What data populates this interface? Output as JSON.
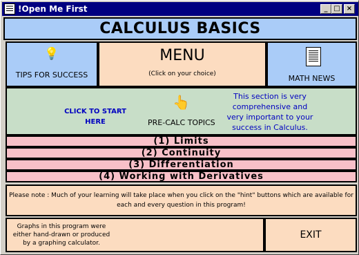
{
  "window": {
    "title": "!Open Me First",
    "minimize_label": "_",
    "maximize_label": "□",
    "close_label": "×"
  },
  "header": {
    "title": "CALCULUS BASICS"
  },
  "nav": {
    "tips_icon": "💡",
    "tips_label": "TIPS FOR SUCCESS",
    "menu_title": "MENU",
    "menu_subtitle": "(Click on your choice)",
    "news_label": "MATH NEWS"
  },
  "precalc": {
    "click_start": "CLICK TO START HERE",
    "hand_icon": "👆",
    "label": "PRE-CALC TOPICS",
    "description": "This section is very comprehensive and very important to your success in Calculus."
  },
  "topics": [
    {
      "label": "(1)  Limits"
    },
    {
      "label": "(2)  Continuity"
    },
    {
      "label": "(3)  Differentiation"
    },
    {
      "label": "(4)  Working with Derivatives"
    }
  ],
  "note": {
    "text": "Please note : Much of your learning will take place when you click on the \"hint\" buttons which are available for each and every question in this program!"
  },
  "footer": {
    "graphs_text": "Graphs in this program were either hand-drawn or produced by a graphing calculator.",
    "exit_label": "EXIT"
  },
  "icons": {
    "tips": "lightbulb-icon",
    "news": "document-icon",
    "precalc": "pointing-hand-icon"
  }
}
